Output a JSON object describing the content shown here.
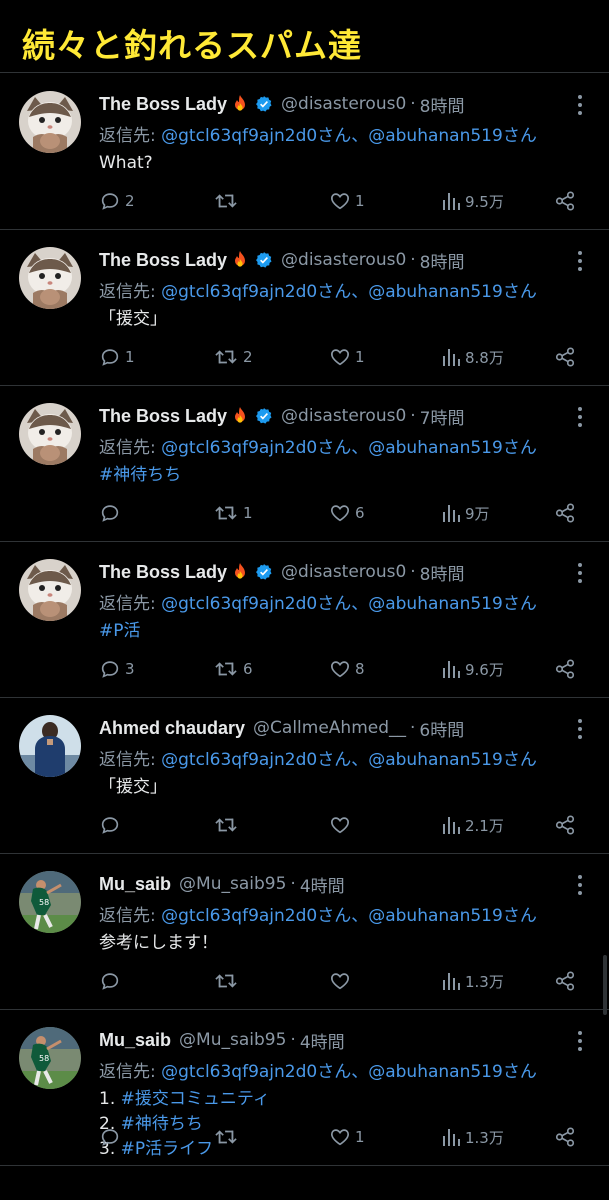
{
  "banner": {
    "title": "続々と釣れるスパム達"
  },
  "tweets": [
    {
      "name": "The Boss Lady",
      "fire": true,
      "verified": true,
      "handle": "@disasterous0",
      "time": "8時間",
      "reply_prefix": "返信先: ",
      "mentions": "@gtcl63qf9ajn2d0さん、@abuhanan519さん",
      "body": [
        {
          "text": "What?",
          "link": false
        }
      ],
      "replies": "2",
      "retweets": "",
      "likes": "1",
      "views": "9.5万",
      "avatar": "cat"
    },
    {
      "name": "The Boss Lady",
      "fire": true,
      "verified": true,
      "handle": "@disasterous0",
      "time": "8時間",
      "reply_prefix": "返信先: ",
      "mentions": "@gtcl63qf9ajn2d0さん、@abuhanan519さん",
      "body": [
        {
          "text": "「援交」",
          "link": false
        }
      ],
      "replies": "1",
      "retweets": "2",
      "likes": "1",
      "views": "8.8万",
      "avatar": "cat"
    },
    {
      "name": "The Boss Lady",
      "fire": true,
      "verified": true,
      "handle": "@disasterous0",
      "time": "7時間",
      "reply_prefix": "返信先: ",
      "mentions": "@gtcl63qf9ajn2d0さん、@abuhanan519さん",
      "body": [
        {
          "text": "#神待ちち",
          "link": true
        }
      ],
      "replies": "",
      "retweets": "1",
      "likes": "6",
      "views": "9万",
      "avatar": "cat"
    },
    {
      "name": "The Boss Lady",
      "fire": true,
      "verified": true,
      "handle": "@disasterous0",
      "time": "8時間",
      "reply_prefix": "返信先: ",
      "mentions": "@gtcl63qf9ajn2d0さん、@abuhanan519さん",
      "body": [
        {
          "text": "#P活",
          "link": true
        }
      ],
      "replies": "3",
      "retweets": "6",
      "likes": "8",
      "views": "9.6万",
      "avatar": "cat"
    },
    {
      "name": "Ahmed chaudary",
      "fire": false,
      "verified": false,
      "handle": "@CallmeAhmed__",
      "time": "6時間",
      "reply_prefix": "返信先: ",
      "mentions": "@gtcl63qf9ajn2d0さん、@abuhanan519さん",
      "body": [
        {
          "text": "「援交」",
          "link": false
        }
      ],
      "replies": "",
      "retweets": "",
      "likes": "",
      "views": "2.1万",
      "avatar": "man"
    },
    {
      "name": "Mu_saib",
      "fire": false,
      "verified": false,
      "handle": "@Mu_saib95",
      "time": "4時間",
      "reply_prefix": "返信先: ",
      "mentions": "@gtcl63qf9ajn2d0さん、@abuhanan519さん",
      "body": [
        {
          "text": "参考にします！",
          "link": false
        }
      ],
      "replies": "",
      "retweets": "",
      "likes": "",
      "views": "1.3万",
      "avatar": "player"
    },
    {
      "name": "Mu_saib",
      "fire": false,
      "verified": false,
      "handle": "@Mu_saib95",
      "time": "4時間",
      "reply_prefix": "返信先: ",
      "mentions": "@gtcl63qf9ajn2d0さん、@abuhanan519さん",
      "body": [
        {
          "num": "1. ",
          "text": "#援交コミュニティ",
          "link": true
        },
        {
          "num": "2. ",
          "text": "#神待ちち",
          "link": true
        },
        {
          "num": "3. ",
          "text": "#P活ライフ",
          "link": true
        }
      ],
      "replies": "",
      "retweets": "",
      "likes": "1",
      "views": "1.3万",
      "avatar": "player"
    }
  ],
  "colors": {
    "accent": "#ffe936",
    "link": "#4a99e9",
    "muted": "#8b98a5",
    "bg": "#000000",
    "divider": "#2f3336"
  },
  "icons": [
    "reply-icon",
    "retweet-icon",
    "like-icon",
    "views-icon",
    "share-icon",
    "more-icon",
    "verified-icon",
    "fire-icon"
  ]
}
